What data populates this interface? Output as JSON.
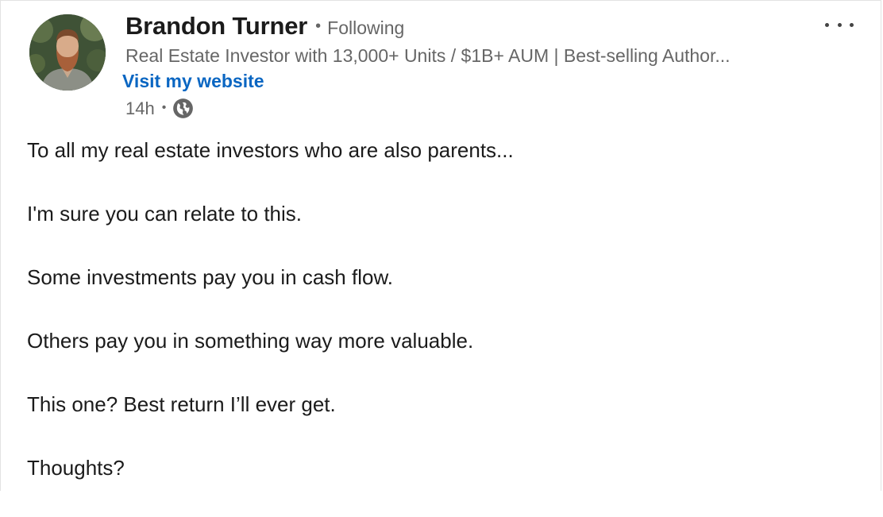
{
  "author": {
    "name": "Brandon Turner",
    "separator": "•",
    "follow_status": "Following",
    "headline": "Real Estate Investor with 13,000+ Units / $1B+ AUM | Best-selling Author...",
    "website_link": "Visit my website",
    "avatar_icon": "profile-photo"
  },
  "post_meta": {
    "time": "14h",
    "separator": "•",
    "visibility_icon": "globe-icon"
  },
  "menu": {
    "icon": "more-options-icon"
  },
  "post": {
    "lines": [
      "To all my real estate investors who are also parents...",
      "I'm sure you can relate to this.",
      "Some investments pay you in cash flow.",
      "Others pay you in something way more valuable.",
      "This one? Best return I’ll ever get.",
      "Thoughts?"
    ]
  },
  "colors": {
    "link": "#0a66c2",
    "secondary_text": "#666666",
    "primary_text": "#1b1b1b"
  }
}
